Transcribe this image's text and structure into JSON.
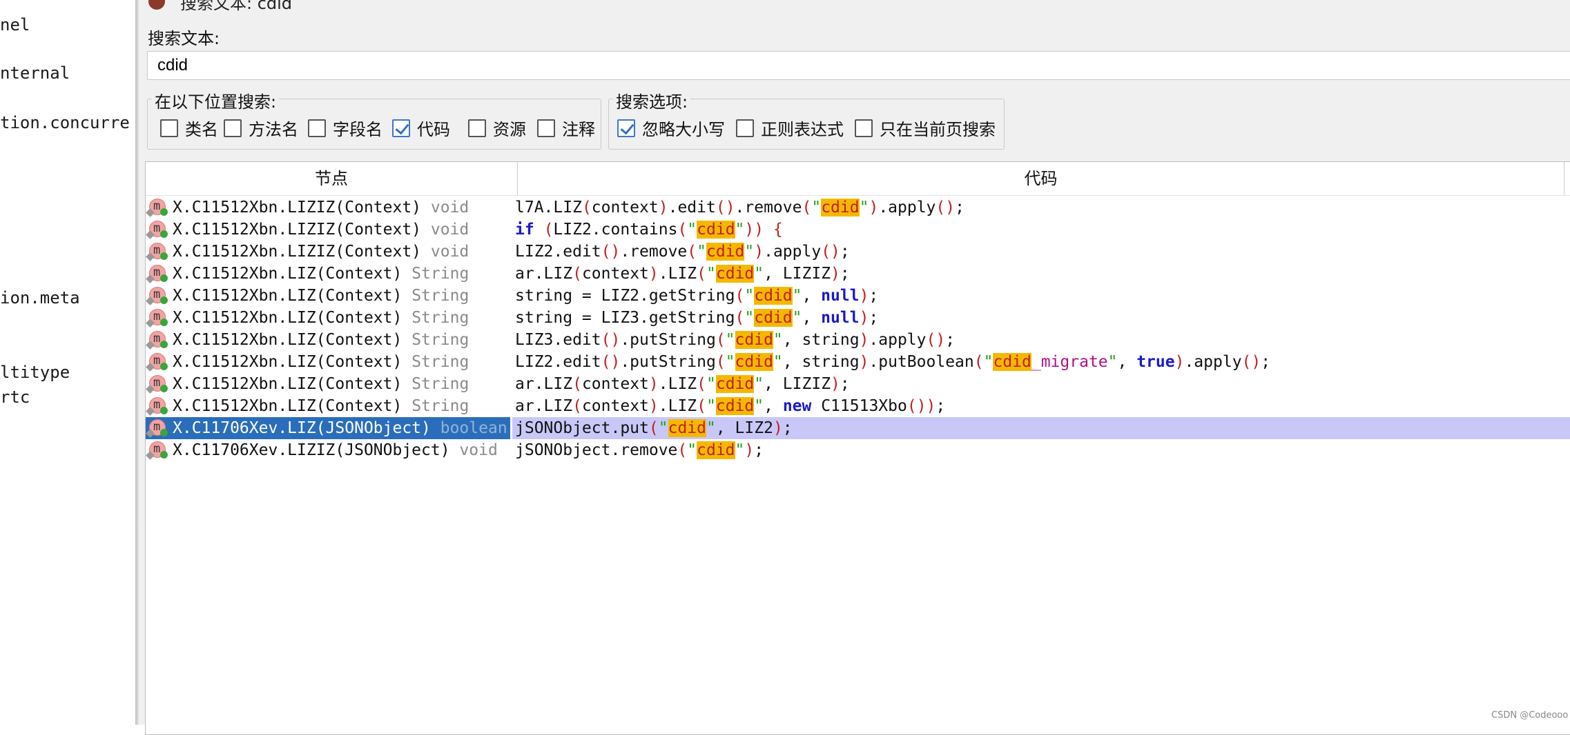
{
  "left_panel": {
    "items": [
      "nel",
      "nternal",
      "tion.concurre",
      "ion.meta",
      "ltitype",
      "rtc"
    ]
  },
  "dialog": {
    "title": "搜索文本: cdid",
    "search_label": "搜索文本:",
    "search_value": "cdid",
    "location_group": {
      "title": "在以下位置搜索:",
      "options": [
        {
          "label": "类名",
          "checked": false
        },
        {
          "label": "方法名",
          "checked": false
        },
        {
          "label": "字段名",
          "checked": false
        },
        {
          "label": "代码",
          "checked": true
        },
        {
          "label": "资源",
          "checked": false
        },
        {
          "label": "注释",
          "checked": false
        }
      ]
    },
    "options_group": {
      "title": "搜索选项:",
      "options": [
        {
          "label": "忽略大小写",
          "checked": true
        },
        {
          "label": "正则表达式",
          "checked": false
        },
        {
          "label": "只在当前页搜索",
          "checked": false
        }
      ]
    },
    "table": {
      "columns": [
        "节点",
        "代码"
      ],
      "rows": [
        {
          "node": "X.C11512Xbn.LIZIZ(Context)",
          "type": "void",
          "code": [
            [
              "t",
              "l7A.LIZ"
            ],
            [
              "p",
              "("
            ],
            [
              "t",
              "context"
            ],
            [
              "p",
              ")"
            ],
            [
              "t",
              ".edit"
            ],
            [
              "p",
              "()"
            ],
            [
              "t",
              ".remove"
            ],
            [
              "p",
              "("
            ],
            [
              "s",
              "\""
            ],
            [
              "h",
              "cdid"
            ],
            [
              "s",
              "\""
            ],
            [
              "p",
              ")"
            ],
            [
              "t",
              ".apply"
            ],
            [
              "p",
              "()"
            ],
            [
              "t",
              ";"
            ]
          ]
        },
        {
          "node": "X.C11512Xbn.LIZIZ(Context)",
          "type": "void",
          "code": [
            [
              "k",
              "if"
            ],
            [
              "t",
              " "
            ],
            [
              "p",
              "("
            ],
            [
              "t",
              "LIZ2.contains"
            ],
            [
              "p",
              "("
            ],
            [
              "s",
              "\""
            ],
            [
              "h",
              "cdid"
            ],
            [
              "s",
              "\""
            ],
            [
              "p",
              "))"
            ],
            [
              "t",
              " "
            ],
            [
              "p",
              "{"
            ]
          ]
        },
        {
          "node": "X.C11512Xbn.LIZIZ(Context)",
          "type": "void",
          "code": [
            [
              "t",
              "LIZ2.edit"
            ],
            [
              "p",
              "()"
            ],
            [
              "t",
              ".remove"
            ],
            [
              "p",
              "("
            ],
            [
              "s",
              "\""
            ],
            [
              "h",
              "cdid"
            ],
            [
              "s",
              "\""
            ],
            [
              "p",
              ")"
            ],
            [
              "t",
              ".apply"
            ],
            [
              "p",
              "()"
            ],
            [
              "t",
              ";"
            ]
          ]
        },
        {
          "node": "X.C11512Xbn.LIZ(Context)",
          "type": "String",
          "code": [
            [
              "t",
              "ar.LIZ"
            ],
            [
              "p",
              "("
            ],
            [
              "t",
              "context"
            ],
            [
              "p",
              ")"
            ],
            [
              "t",
              ".LIZ"
            ],
            [
              "p",
              "("
            ],
            [
              "s",
              "\""
            ],
            [
              "h",
              "cdid"
            ],
            [
              "s",
              "\""
            ],
            [
              "t",
              ", LIZIZ"
            ],
            [
              "p",
              ")"
            ],
            [
              "t",
              ";"
            ]
          ]
        },
        {
          "node": "X.C11512Xbn.LIZ(Context)",
          "type": "String",
          "code": [
            [
              "t",
              "string = LIZ2.getString"
            ],
            [
              "p",
              "("
            ],
            [
              "s",
              "\""
            ],
            [
              "h",
              "cdid"
            ],
            [
              "s",
              "\""
            ],
            [
              "t",
              ", "
            ],
            [
              "k",
              "null"
            ],
            [
              "p",
              ")"
            ],
            [
              "t",
              ";"
            ]
          ]
        },
        {
          "node": "X.C11512Xbn.LIZ(Context)",
          "type": "String",
          "code": [
            [
              "t",
              "string = LIZ3.getString"
            ],
            [
              "p",
              "("
            ],
            [
              "s",
              "\""
            ],
            [
              "h",
              "cdid"
            ],
            [
              "s",
              "\""
            ],
            [
              "t",
              ", "
            ],
            [
              "k",
              "null"
            ],
            [
              "p",
              ")"
            ],
            [
              "t",
              ";"
            ]
          ]
        },
        {
          "node": "X.C11512Xbn.LIZ(Context)",
          "type": "String",
          "code": [
            [
              "t",
              "LIZ3.edit"
            ],
            [
              "p",
              "()"
            ],
            [
              "t",
              ".putString"
            ],
            [
              "p",
              "("
            ],
            [
              "s",
              "\""
            ],
            [
              "h",
              "cdid"
            ],
            [
              "s",
              "\""
            ],
            [
              "t",
              ", string"
            ],
            [
              "p",
              ")"
            ],
            [
              "t",
              ".apply"
            ],
            [
              "p",
              "()"
            ],
            [
              "t",
              ";"
            ]
          ]
        },
        {
          "node": "X.C11512Xbn.LIZ(Context)",
          "type": "String",
          "code": [
            [
              "t",
              "LIZ2.edit"
            ],
            [
              "p",
              "()"
            ],
            [
              "t",
              ".putString"
            ],
            [
              "p",
              "("
            ],
            [
              "s",
              "\""
            ],
            [
              "h",
              "cdid"
            ],
            [
              "s",
              "\""
            ],
            [
              "t",
              ", string"
            ],
            [
              "p",
              ")"
            ],
            [
              "t",
              ".putBoolean"
            ],
            [
              "p",
              "("
            ],
            [
              "s",
              "\""
            ],
            [
              "h",
              "cdid"
            ],
            [
              "m",
              "_migrate"
            ],
            [
              "s",
              "\""
            ],
            [
              "t",
              ", "
            ],
            [
              "k",
              "true"
            ],
            [
              "p",
              ")"
            ],
            [
              "t",
              ".apply"
            ],
            [
              "p",
              "()"
            ],
            [
              "t",
              ";"
            ]
          ]
        },
        {
          "node": "X.C11512Xbn.LIZ(Context)",
          "type": "String",
          "code": [
            [
              "t",
              "ar.LIZ"
            ],
            [
              "p",
              "("
            ],
            [
              "t",
              "context"
            ],
            [
              "p",
              ")"
            ],
            [
              "t",
              ".LIZ"
            ],
            [
              "p",
              "("
            ],
            [
              "s",
              "\""
            ],
            [
              "h",
              "cdid"
            ],
            [
              "s",
              "\""
            ],
            [
              "t",
              ", LIZIZ"
            ],
            [
              "p",
              ")"
            ],
            [
              "t",
              ";"
            ]
          ]
        },
        {
          "node": "X.C11512Xbn.LIZ(Context)",
          "type": "String",
          "code": [
            [
              "t",
              "ar.LIZ"
            ],
            [
              "p",
              "("
            ],
            [
              "t",
              "context"
            ],
            [
              "p",
              ")"
            ],
            [
              "t",
              ".LIZ"
            ],
            [
              "p",
              "("
            ],
            [
              "s",
              "\""
            ],
            [
              "h",
              "cdid"
            ],
            [
              "s",
              "\""
            ],
            [
              "t",
              ", "
            ],
            [
              "k",
              "new"
            ],
            [
              "t",
              " C11513Xbo"
            ],
            [
              "p",
              "())"
            ],
            [
              "t",
              ";"
            ]
          ]
        },
        {
          "node": "X.C11706Xev.LIZ(JSONObject)",
          "type": "boolean",
          "selected": true,
          "code": [
            [
              "t",
              "jSONObject.put"
            ],
            [
              "p",
              "("
            ],
            [
              "s",
              "\""
            ],
            [
              "h",
              "cdid"
            ],
            [
              "s",
              "\""
            ],
            [
              "t",
              ", LIZ2"
            ],
            [
              "p",
              ")"
            ],
            [
              "t",
              ";"
            ]
          ]
        },
        {
          "node": "X.C11706Xev.LIZIZ(JSONObject)",
          "type": "void",
          "code": [
            [
              "t",
              "jSONObject.remove"
            ],
            [
              "p",
              "("
            ],
            [
              "s",
              "\""
            ],
            [
              "h",
              "cdid"
            ],
            [
              "s",
              "\""
            ],
            [
              "p",
              ")"
            ],
            [
              "t",
              ";"
            ]
          ]
        }
      ]
    }
  },
  "watermark": "CSDN @Codeooo"
}
